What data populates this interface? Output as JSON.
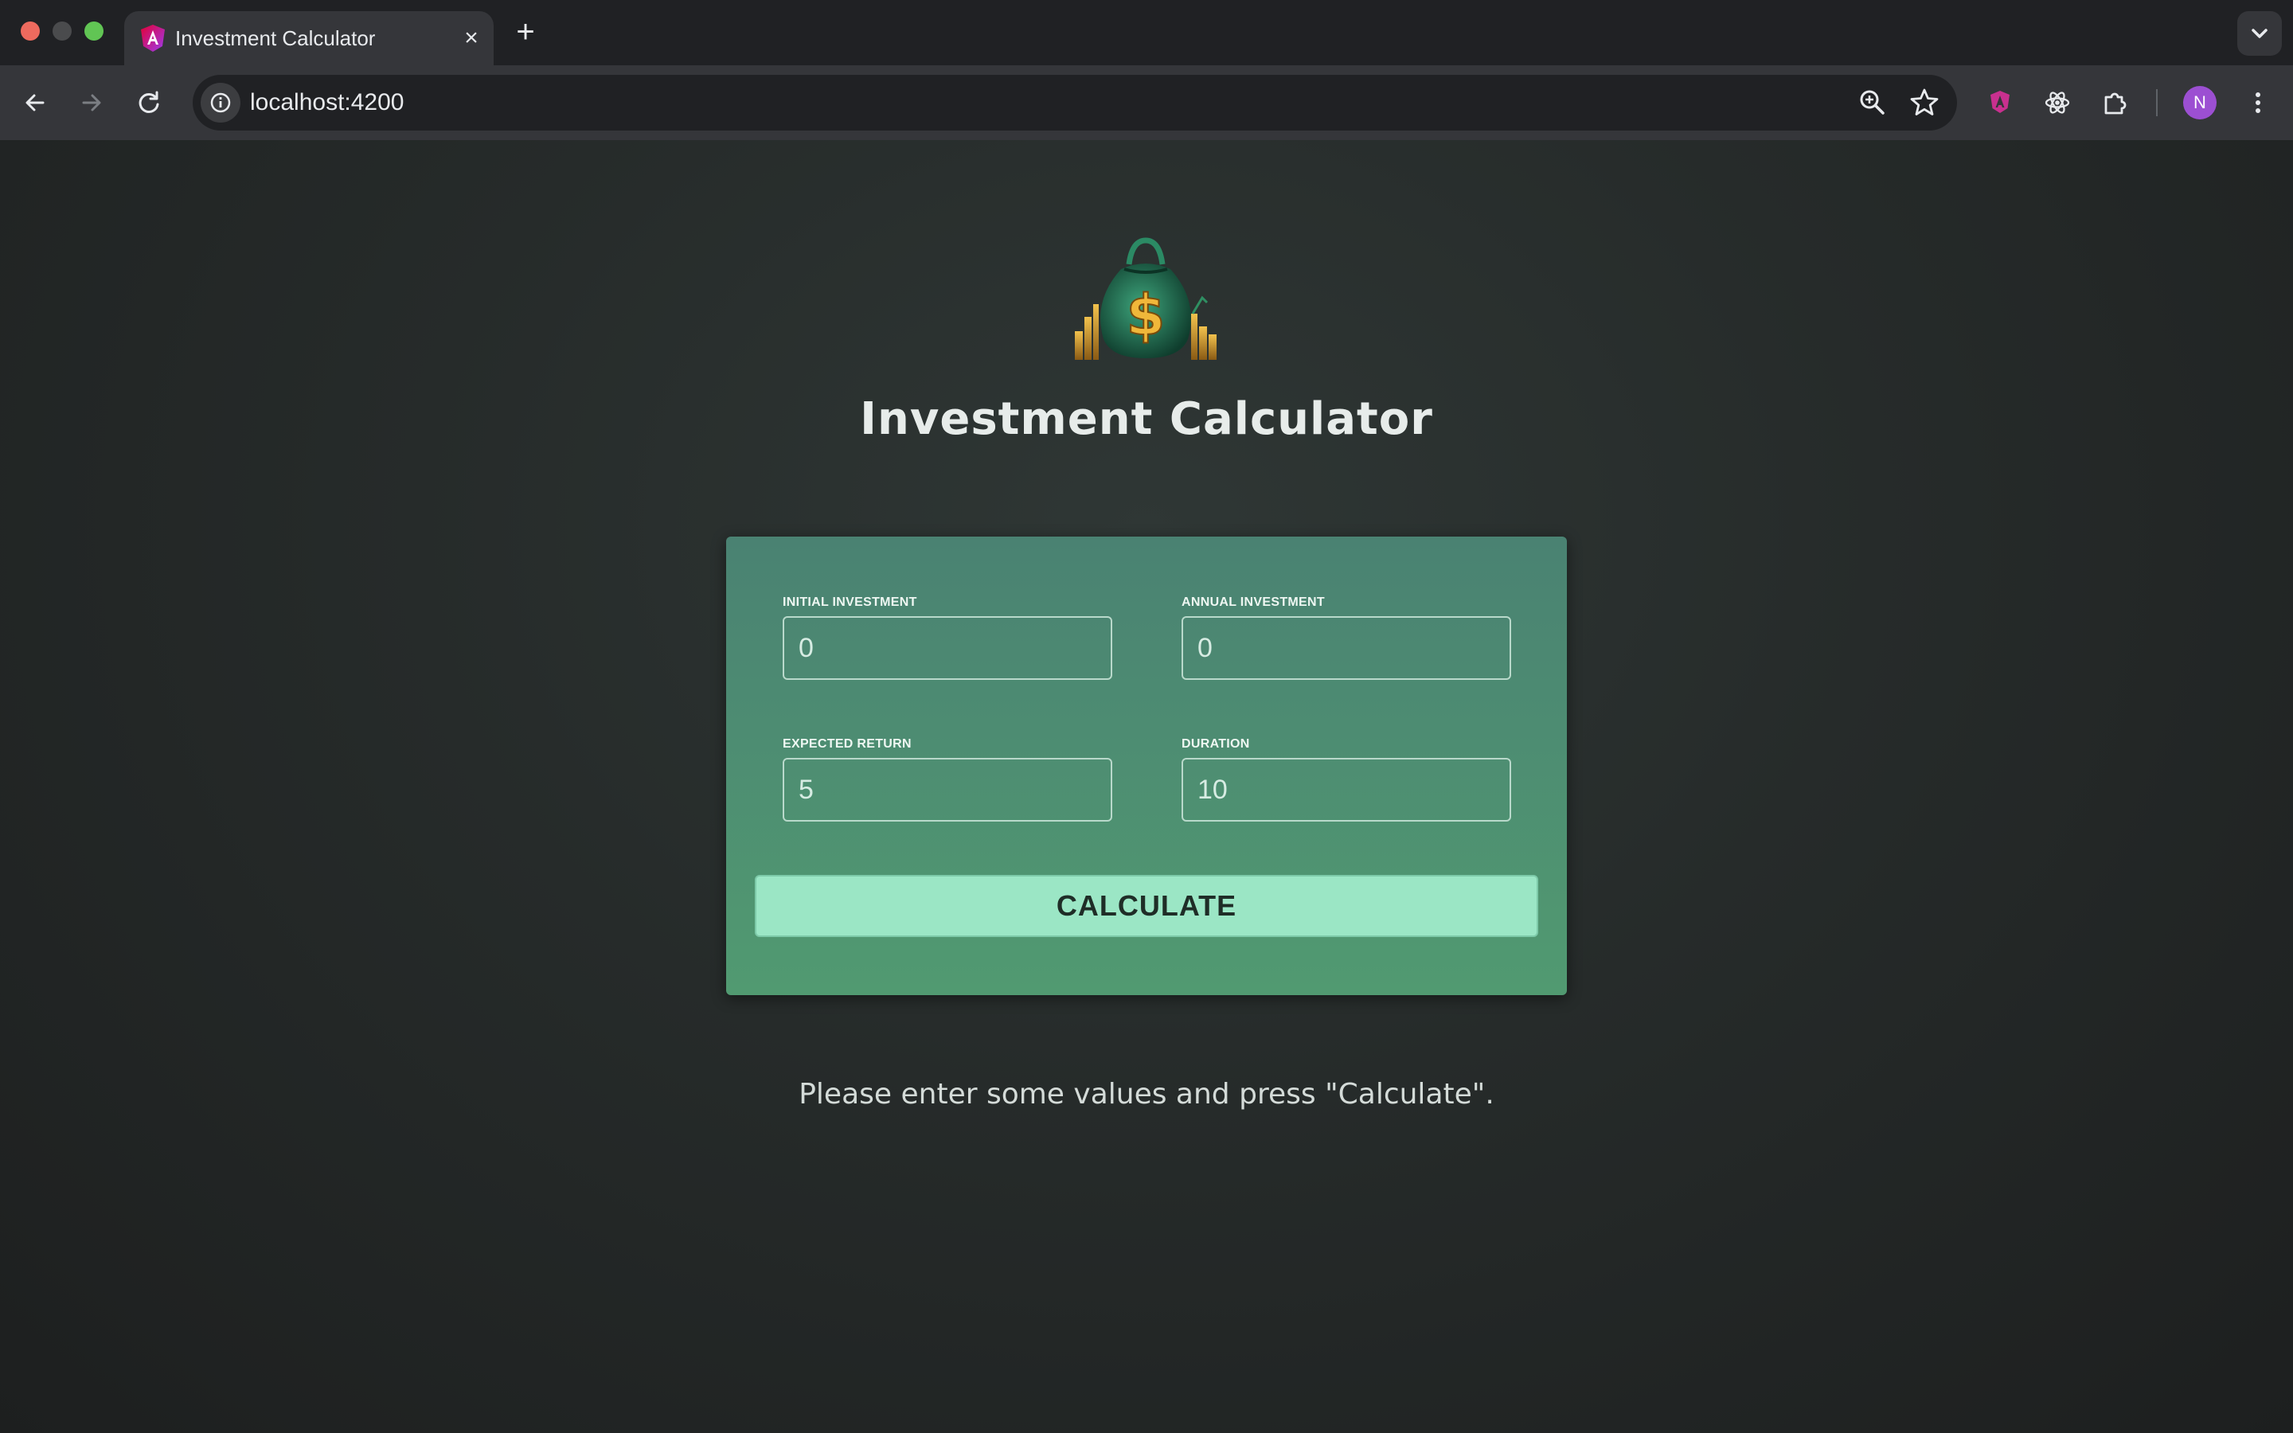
{
  "browser": {
    "tab_title": "Investment Calculator",
    "tab_close": "×",
    "new_tab": "+",
    "url": "localhost:4200",
    "avatar_initial": "N"
  },
  "page": {
    "title": "Investment Calculator",
    "logo_icon": "money-bag-icon"
  },
  "form": {
    "fields": [
      {
        "label": "INITIAL INVESTMENT",
        "value": "0"
      },
      {
        "label": "ANNUAL INVESTMENT",
        "value": "0"
      },
      {
        "label": "EXPECTED RETURN",
        "value": "5"
      },
      {
        "label": "DURATION",
        "value": "10"
      }
    ],
    "submit_label": "CALCULATE"
  },
  "hint": "Please enter some values and press \"Calculate\".",
  "colors": {
    "card": "#4f8c73",
    "button": "#9be6c5",
    "background": "#262b2a"
  }
}
